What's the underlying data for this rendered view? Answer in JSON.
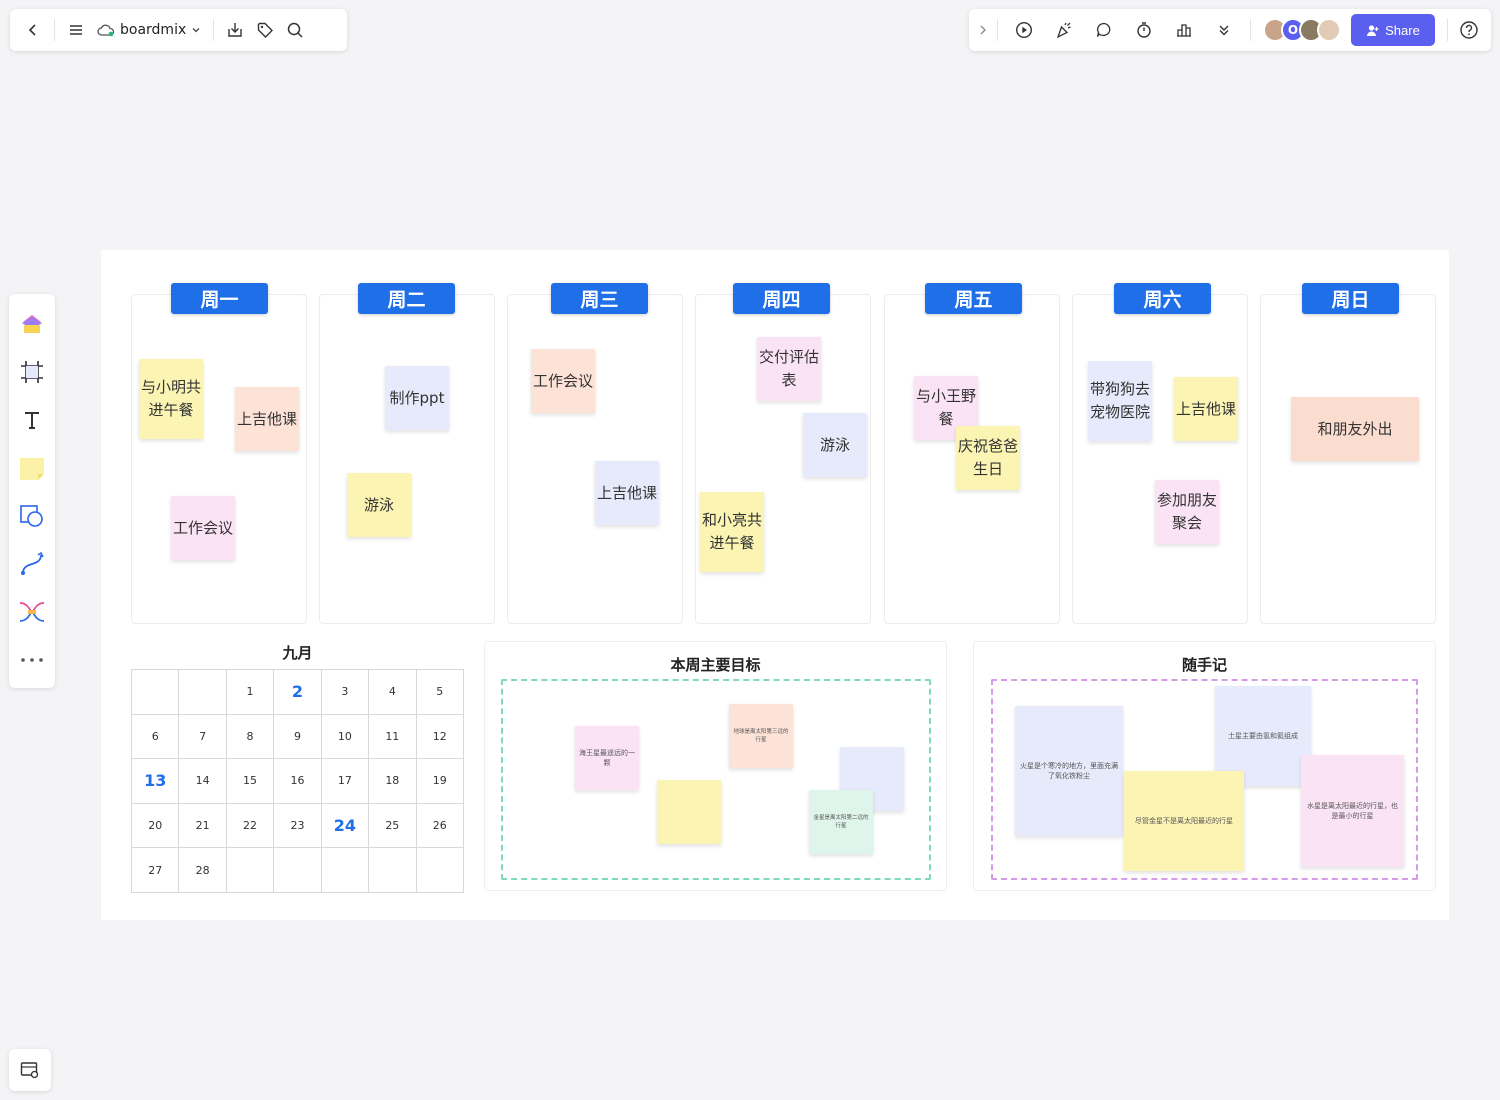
{
  "toolbar": {
    "brand": "boardmix",
    "share_label": "Share",
    "avatar_letter": "O"
  },
  "board": {
    "days": [
      "周一",
      "周二",
      "周三",
      "周四",
      "周五",
      "周六",
      "周日"
    ],
    "notes": {
      "mon1": "与小明共进午餐",
      "mon2": "上吉他课",
      "mon3": "工作会议",
      "tue1": "制作ppt",
      "tue2": "游泳",
      "wed1": "工作会议",
      "wed2": "上吉他课",
      "thu1": "交付评估表",
      "thu2": "游泳",
      "thu3": "和小亮共进午餐",
      "fri1": "与小王野餐",
      "fri2": "庆祝爸爸生日",
      "sat1": "带狗狗去宠物医院",
      "sat2": "上吉他课",
      "sat3": "参加朋友聚会",
      "sun1": "和朋友外出"
    }
  },
  "calendar": {
    "title": "九月",
    "rows": [
      [
        "",
        "",
        "1",
        "2",
        "3",
        "4",
        "5"
      ],
      [
        "6",
        "7",
        "8",
        "9",
        "10",
        "11",
        "12"
      ],
      [
        "13",
        "14",
        "15",
        "16",
        "17",
        "18",
        "19"
      ],
      [
        "20",
        "21",
        "22",
        "23",
        "24",
        "25",
        "26"
      ],
      [
        "27",
        "28",
        "",
        "",
        "",
        "",
        ""
      ]
    ],
    "highlighted": [
      "2",
      "13",
      "24"
    ]
  },
  "goals": {
    "title": "本周主要目标",
    "notes": {
      "n1": "海王星最遥远的一颗",
      "n2": "地球是离太阳第三远的行星",
      "n3": "金星是离太阳第二远的行星"
    }
  },
  "memo": {
    "title": "随手记",
    "notes": {
      "n1": "火星是个寒冷的地方，里面充满了氧化铁粉尘",
      "n2": "土星主要由氢和氦组成",
      "n3": "尽管金星不是离太阳最近的行星",
      "n4": "水星是离太阳最近的行星，也是最小的行星"
    }
  },
  "colors": {
    "accent": "#1f6fe8",
    "share": "#5b5ff0",
    "goals_dash": "#7fd8c0",
    "memo_dash": "#d39be8"
  }
}
